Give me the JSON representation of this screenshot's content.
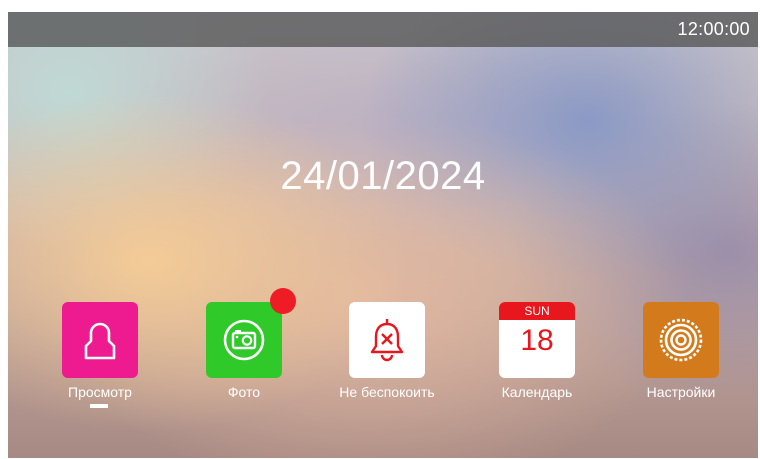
{
  "status_bar": {
    "time": "12:00:00"
  },
  "home": {
    "date": "24/01/2024"
  },
  "apps": [
    {
      "label": "Просмотр",
      "icon": "user-icon",
      "color": "#ee1a8f",
      "focused": true
    },
    {
      "label": "Фото",
      "icon": "camera-icon",
      "color": "#2fc92a",
      "has_notification_badge": true,
      "badge_color": "#ee1c25"
    },
    {
      "label": "Не беспокоить",
      "icon": "bell-muted-icon",
      "color": "#ffffff",
      "icon_color": "#e8161d"
    },
    {
      "label": "Календарь",
      "icon": "calendar-icon",
      "color": "#ffffff",
      "calendar_weekday": "SUN",
      "calendar_day": "18",
      "accent": "#e8161d"
    },
    {
      "label": "Настройки",
      "icon": "settings-icon",
      "color": "#d27a1c"
    }
  ]
}
